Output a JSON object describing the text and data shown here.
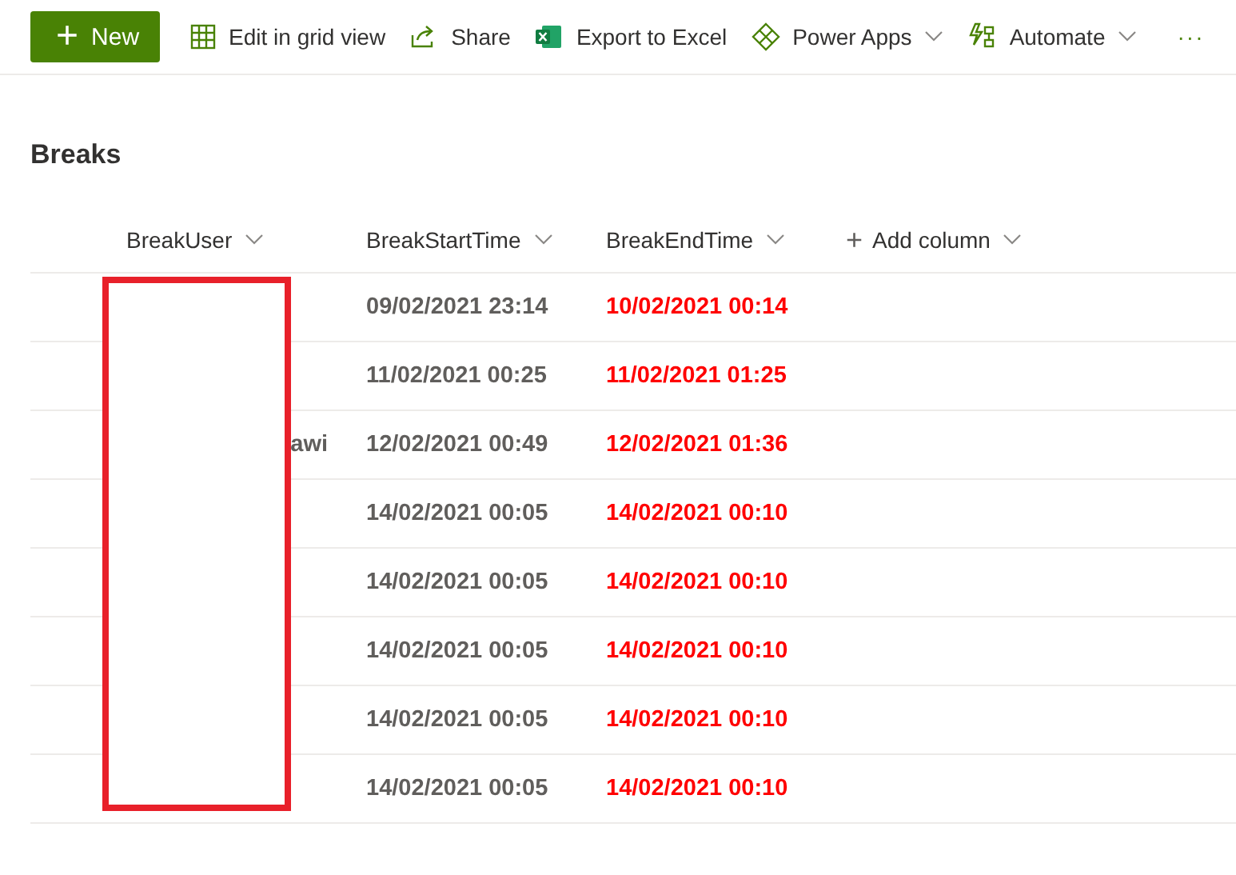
{
  "toolbar": {
    "primary": {
      "icon": "+",
      "label": "New"
    },
    "items": [
      {
        "kind": "grid",
        "label": "Edit in grid view",
        "dropdown": false
      },
      {
        "kind": "share",
        "label": "Share",
        "dropdown": false
      },
      {
        "kind": "excel",
        "label": "Export to Excel",
        "dropdown": false
      },
      {
        "kind": "powerapps",
        "label": "Power Apps",
        "dropdown": true
      },
      {
        "kind": "automate",
        "label": "Automate",
        "dropdown": true
      }
    ],
    "more": "···"
  },
  "list": {
    "title": "Breaks",
    "columns": [
      {
        "label": "BreakUser",
        "kind": "sort"
      },
      {
        "label": "BreakStartTime",
        "kind": "sort"
      },
      {
        "label": "BreakEndTime",
        "kind": "sort"
      },
      {
        "label": "Add column",
        "kind": "add",
        "icon": "+"
      }
    ],
    "rows": [
      {
        "start": "09/02/2021 23:14",
        "end": "10/02/2021 00:14"
      },
      {
        "start": "11/02/2021 00:25",
        "end": "11/02/2021 01:25"
      },
      {
        "user": "awi",
        "start": "12/02/2021 00:49",
        "end": "12/02/2021 01:36"
      },
      {
        "start": "14/02/2021 00:05",
        "end": "14/02/2021 00:10"
      },
      {
        "start": "14/02/2021 00:05",
        "end": "14/02/2021 00:10"
      },
      {
        "start": "14/02/2021 00:05",
        "end": "14/02/2021 00:10"
      },
      {
        "start": "14/02/2021 00:05",
        "end": "14/02/2021 00:10"
      },
      {
        "start": "14/02/2021 00:05",
        "end": "14/02/2021 00:10"
      }
    ],
    "redaction": true
  }
}
